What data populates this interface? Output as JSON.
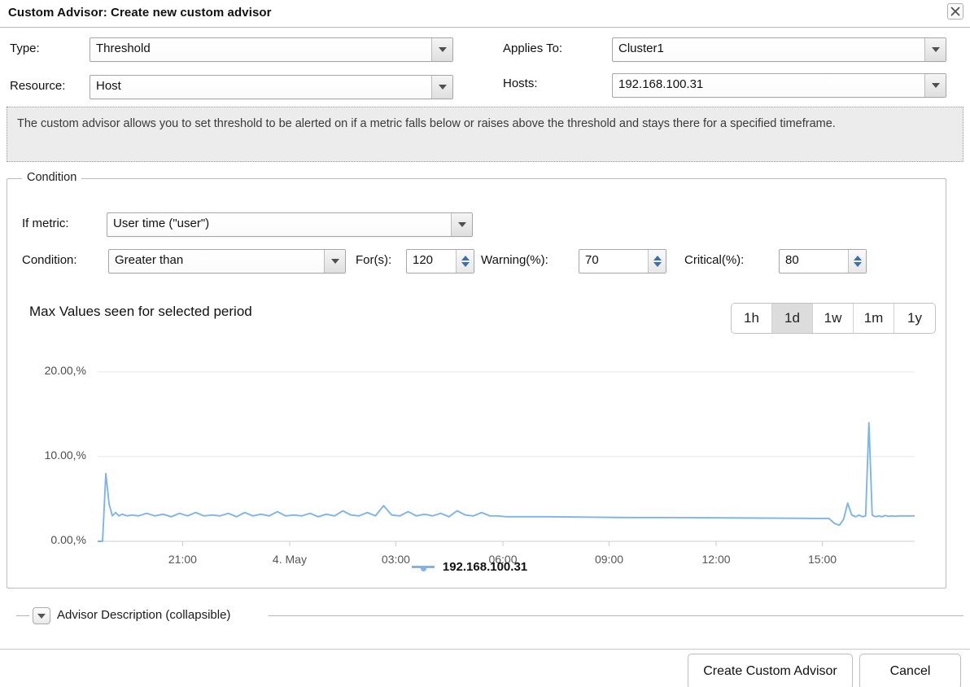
{
  "window": {
    "title": "Custom Advisor: Create new custom advisor",
    "close_icon": "close-icon"
  },
  "form": {
    "type": {
      "label": "Type:",
      "value": "Threshold"
    },
    "resource": {
      "label": "Resource:",
      "value": "Host"
    },
    "applies_to": {
      "label": "Applies To:",
      "value": "Cluster1"
    },
    "hosts": {
      "label": "Hosts:",
      "value": "192.168.100.31"
    }
  },
  "description": "The custom advisor allows you to set threshold to be alerted on if a metric falls below or raises above the threshold and stays there for a specified timeframe.",
  "condition": {
    "legend": "Condition",
    "metric": {
      "label": "If metric:",
      "value": "User time (\"user\")"
    },
    "operator": {
      "label": "Condition:",
      "value": "Greater than"
    },
    "duration": {
      "label": "For(s):",
      "value": "120"
    },
    "warning": {
      "label": "Warning(%):",
      "value": "70"
    },
    "critical": {
      "label": "Critical(%):",
      "value": "80"
    }
  },
  "chart_panel": {
    "title": "Max Values seen for selected period",
    "ranges": [
      {
        "label": "1h",
        "active": false
      },
      {
        "label": "1d",
        "active": true
      },
      {
        "label": "1w",
        "active": false
      },
      {
        "label": "1m",
        "active": false
      },
      {
        "label": "1y",
        "active": false
      }
    ]
  },
  "chart_data": {
    "type": "line",
    "title": "Max Values seen for selected period",
    "xlabel": "",
    "ylabel": "",
    "ylim": [
      0,
      22
    ],
    "yticks": [
      0,
      10,
      20
    ],
    "ytick_labels": [
      "0.00,%",
      "10.00,%",
      "20.00,%"
    ],
    "grid": true,
    "legend_position": "bottom",
    "line_color": "#7cb5ec",
    "xtick_labels": [
      "21:00",
      "4. May",
      "03:00",
      "06:00",
      "09:00",
      "12:00",
      "15:00"
    ],
    "xtick_positions_pct": [
      10.4,
      23.5,
      36.5,
      49.6,
      62.6,
      75.7,
      88.7
    ],
    "series": [
      {
        "name": "192.168.100.31",
        "color": "#7cb5ec",
        "x": [
          0.0,
          0.6,
          1.0,
          1.4,
          1.8,
          2.2,
          2.6,
          3.0,
          3.6,
          4.2,
          5.0,
          6.0,
          7.0,
          8.0,
          9.0,
          10.0,
          11.0,
          12.0,
          13.0,
          14.0,
          15.0,
          16.0,
          17.0,
          18.0,
          19.0,
          20.0,
          21.0,
          22.0,
          23.0,
          24.0,
          25.0,
          26.0,
          27.0,
          28.0,
          29.0,
          30.0,
          31.0,
          32.0,
          33.0,
          34.0,
          35.0,
          36.0,
          37.0,
          38.0,
          39.0,
          40.0,
          41.0,
          42.0,
          43.0,
          44.0,
          45.0,
          46.0,
          47.0,
          48.0,
          49.0,
          50.0,
          52.0,
          55.0,
          60.0,
          65.0,
          70.0,
          75.0,
          80.0,
          85.0,
          88.0,
          89.5,
          90.2,
          90.8,
          91.3,
          91.8,
          92.3,
          92.8,
          93.2,
          93.6,
          94.0,
          94.4,
          94.8,
          95.2,
          95.6,
          96.0,
          96.4,
          96.8,
          97.2,
          97.6,
          98.0,
          98.6,
          99.3,
          100.0
        ],
        "y": [
          0.0,
          0.0,
          8.0,
          4.4,
          3.0,
          3.4,
          3.0,
          3.2,
          3.0,
          3.1,
          3.0,
          3.3,
          3.0,
          3.2,
          2.9,
          3.3,
          3.0,
          3.4,
          3.0,
          3.1,
          3.0,
          3.3,
          2.9,
          3.4,
          3.0,
          3.2,
          3.0,
          3.5,
          3.0,
          3.1,
          3.0,
          3.3,
          2.9,
          3.2,
          3.0,
          3.6,
          3.1,
          3.0,
          3.4,
          3.0,
          4.2,
          3.1,
          3.0,
          3.5,
          3.0,
          3.2,
          3.0,
          3.3,
          2.9,
          3.6,
          3.1,
          3.0,
          3.4,
          3.0,
          3.0,
          2.9,
          2.9,
          2.9,
          2.85,
          2.8,
          2.8,
          2.78,
          2.75,
          2.72,
          2.7,
          2.7,
          2.1,
          1.9,
          2.6,
          4.5,
          3.1,
          2.9,
          3.1,
          2.9,
          3.0,
          14.0,
          3.1,
          2.9,
          3.0,
          2.9,
          3.05,
          2.95,
          3.0,
          2.95,
          3.0,
          3.0,
          3.0,
          3.0
        ]
      }
    ]
  },
  "advisor_description": {
    "label": "Advisor Description (collapsible)",
    "toggle_icon": "chevron-down-icon"
  },
  "footer": {
    "create_label": "Create Custom Advisor",
    "cancel_label": "Cancel"
  }
}
